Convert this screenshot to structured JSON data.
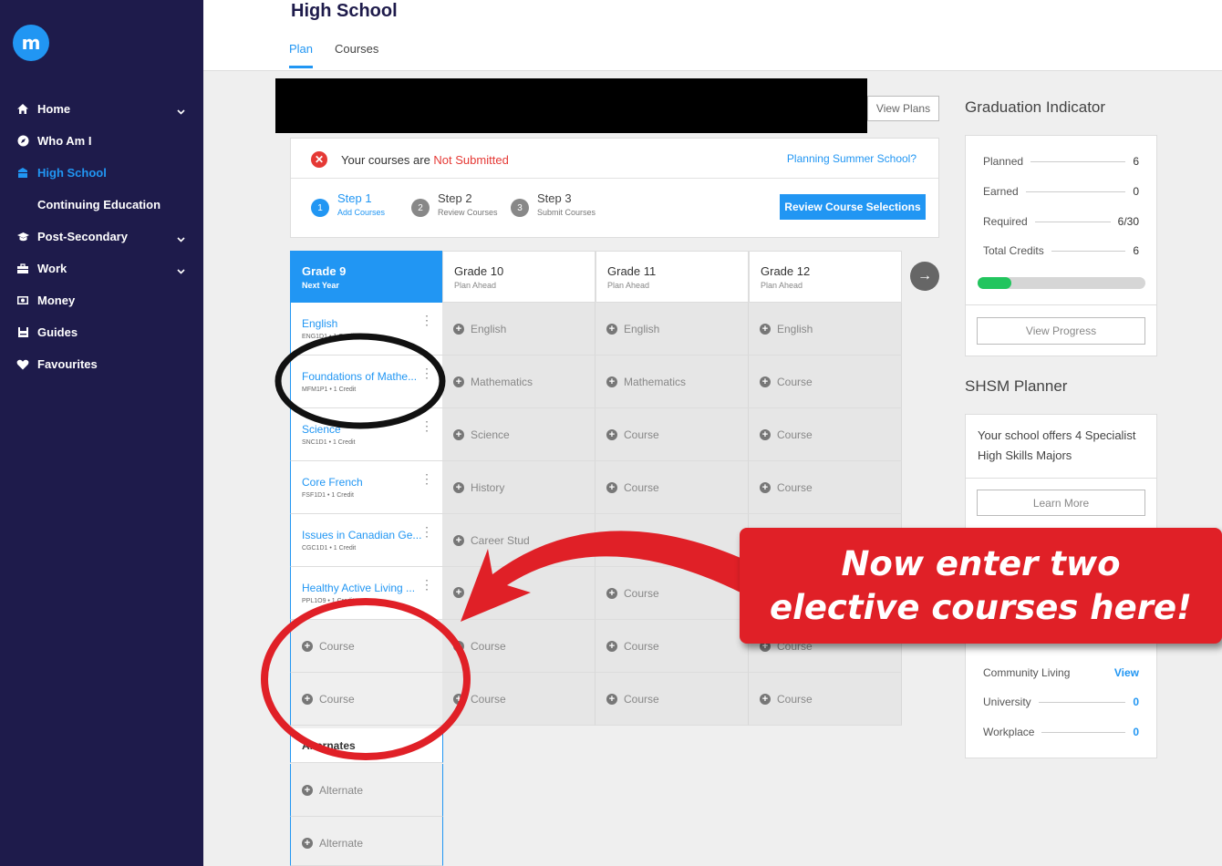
{
  "app": {
    "logo": "m"
  },
  "sidebar": {
    "items": [
      {
        "label": "Home",
        "icon": "home-icon",
        "chevron": true
      },
      {
        "label": "Who Am I",
        "icon": "compass-icon",
        "chevron": false
      },
      {
        "label": "High School",
        "icon": "school-icon",
        "chevron": false,
        "active": true
      },
      {
        "label": "Continuing Education",
        "icon": "",
        "chevron": false,
        "sub": true
      },
      {
        "label": "Post-Secondary",
        "icon": "graduation-cap-icon",
        "chevron": true
      },
      {
        "label": "Work",
        "icon": "briefcase-icon",
        "chevron": true
      },
      {
        "label": "Money",
        "icon": "money-icon",
        "chevron": false
      },
      {
        "label": "Guides",
        "icon": "book-icon",
        "chevron": false
      },
      {
        "label": "Favourites",
        "icon": "heart-icon",
        "chevron": false
      }
    ]
  },
  "header": {
    "title": "High School",
    "tabs": [
      {
        "label": "Plan",
        "active": true
      },
      {
        "label": "Courses",
        "active": false
      }
    ]
  },
  "toolbar": {
    "view_plans": "View Plans"
  },
  "status": {
    "prefix": "Your courses are ",
    "state": "Not Submitted",
    "summer_link": "Planning Summer School?",
    "steps": [
      {
        "num": "1",
        "title": "Step 1",
        "sub": "Add Courses"
      },
      {
        "num": "2",
        "title": "Step 2",
        "sub": "Review Courses"
      },
      {
        "num": "3",
        "title": "Step 3",
        "sub": "Submit Courses"
      }
    ],
    "review_button": "Review Course Selections"
  },
  "plan": {
    "columns": [
      {
        "grade": "Grade 9",
        "sub": "Next Year"
      },
      {
        "grade": "Grade 10",
        "sub": "Plan Ahead"
      },
      {
        "grade": "Grade 11",
        "sub": "Plan Ahead"
      },
      {
        "grade": "Grade 12",
        "sub": "Plan Ahead"
      }
    ],
    "grade9": [
      {
        "name": "English",
        "code": "ENG1D1 • 1 Credit"
      },
      {
        "name": "Foundations of Mathe...",
        "code": "MFM1P1 • 1 Credit"
      },
      {
        "name": "Science",
        "code": "SNC1D1 • 1 Credit"
      },
      {
        "name": "Core French",
        "code": "FSF1D1 • 1 Credit"
      },
      {
        "name": "Issues in Canadian Ge...",
        "code": "CGC1D1 • 1 Credit"
      },
      {
        "name": "Healthy Active Living ...",
        "code": "PPL1O9 • 1 Credit"
      }
    ],
    "grade9_empty": [
      "Course",
      "Course"
    ],
    "grade10": [
      "English",
      "Mathematics",
      "Science",
      "History",
      "Career Stud",
      "",
      "Course",
      "Course"
    ],
    "grade11": [
      "English",
      "Mathematics",
      "Course",
      "Course",
      "Course",
      "Course",
      "Course",
      "Course"
    ],
    "grade12": [
      "English",
      "Course",
      "Course",
      "Course",
      "",
      "",
      "Course",
      "Course"
    ],
    "alternates_label": "Alternates",
    "alternates": [
      "Alternate",
      "Alternate"
    ]
  },
  "graduation": {
    "title": "Graduation Indicator",
    "rows": [
      {
        "label": "Planned",
        "value": "6"
      },
      {
        "label": "Earned",
        "value": "0"
      },
      {
        "label": "Required",
        "value": "6/30"
      },
      {
        "label": "Total Credits",
        "value": "6"
      }
    ],
    "progress": 0.2,
    "button": "View Progress"
  },
  "shsm": {
    "title": "SHSM Planner",
    "text": "Your school offers 4 Specialist High Skills Majors",
    "button": "Learn More"
  },
  "pathways": {
    "rows": [
      {
        "label": "Community Living",
        "value": "View",
        "link": true
      },
      {
        "label": "University",
        "value": "0",
        "link": true
      },
      {
        "label": "Workplace",
        "value": "0",
        "link": true
      }
    ]
  },
  "annotation": {
    "callout": "Now enter two elective courses here!",
    "arrow_color": "#e02027",
    "circle_dark_color": "#111111",
    "circle_red_color": "#e02027"
  }
}
